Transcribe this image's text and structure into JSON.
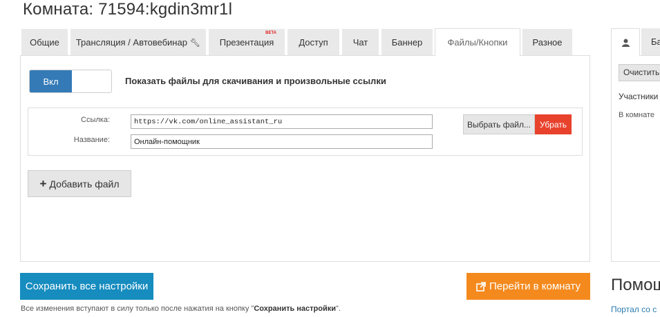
{
  "page": {
    "title": "Комната: 71594:kgdin3mr1l"
  },
  "tabs": [
    {
      "label": "Общие",
      "active": false
    },
    {
      "label": "Трансляция / Автовебинар",
      "active": false
    },
    {
      "label": "Презентация",
      "badge": "BETA",
      "active": false
    },
    {
      "label": "Доступ",
      "active": false
    },
    {
      "label": "Чат",
      "active": false
    },
    {
      "label": "Баннер",
      "active": false
    },
    {
      "label": "Файлы/Кнопки",
      "active": true
    },
    {
      "label": "Разное",
      "active": false
    }
  ],
  "toggle": {
    "on_label": "Вкл",
    "label": "Показать файлы для скачивания и произвольные ссылки"
  },
  "file_item": {
    "link_label": "Ссылка:",
    "link_value": "https://vk.com/online_assistant_ru",
    "name_label": "Название:",
    "name_value": "Онлайн-помощник",
    "choose_button": "Выбрать файл...",
    "remove_button": "Убрать"
  },
  "add_file_button": "Добавить файл",
  "save_button": "Сохранить все настройки",
  "goto_button": "Перейти в комнату",
  "note": {
    "prefix": "Все изменения вступают в силу только после нажатия на кнопку \"",
    "bold": "Сохранить настройки",
    "suffix": "\"."
  },
  "side": {
    "tab2_label": "Ба",
    "clear_button": "Очистить",
    "participants": "Участники",
    "in_room": "В комнате",
    "help_title": "Помощ",
    "help_link": "Портал со с"
  },
  "colors": {
    "primary": "#337ab7",
    "save": "#168cbf",
    "goto": "#f48a1e",
    "remove": "#e8412c"
  }
}
